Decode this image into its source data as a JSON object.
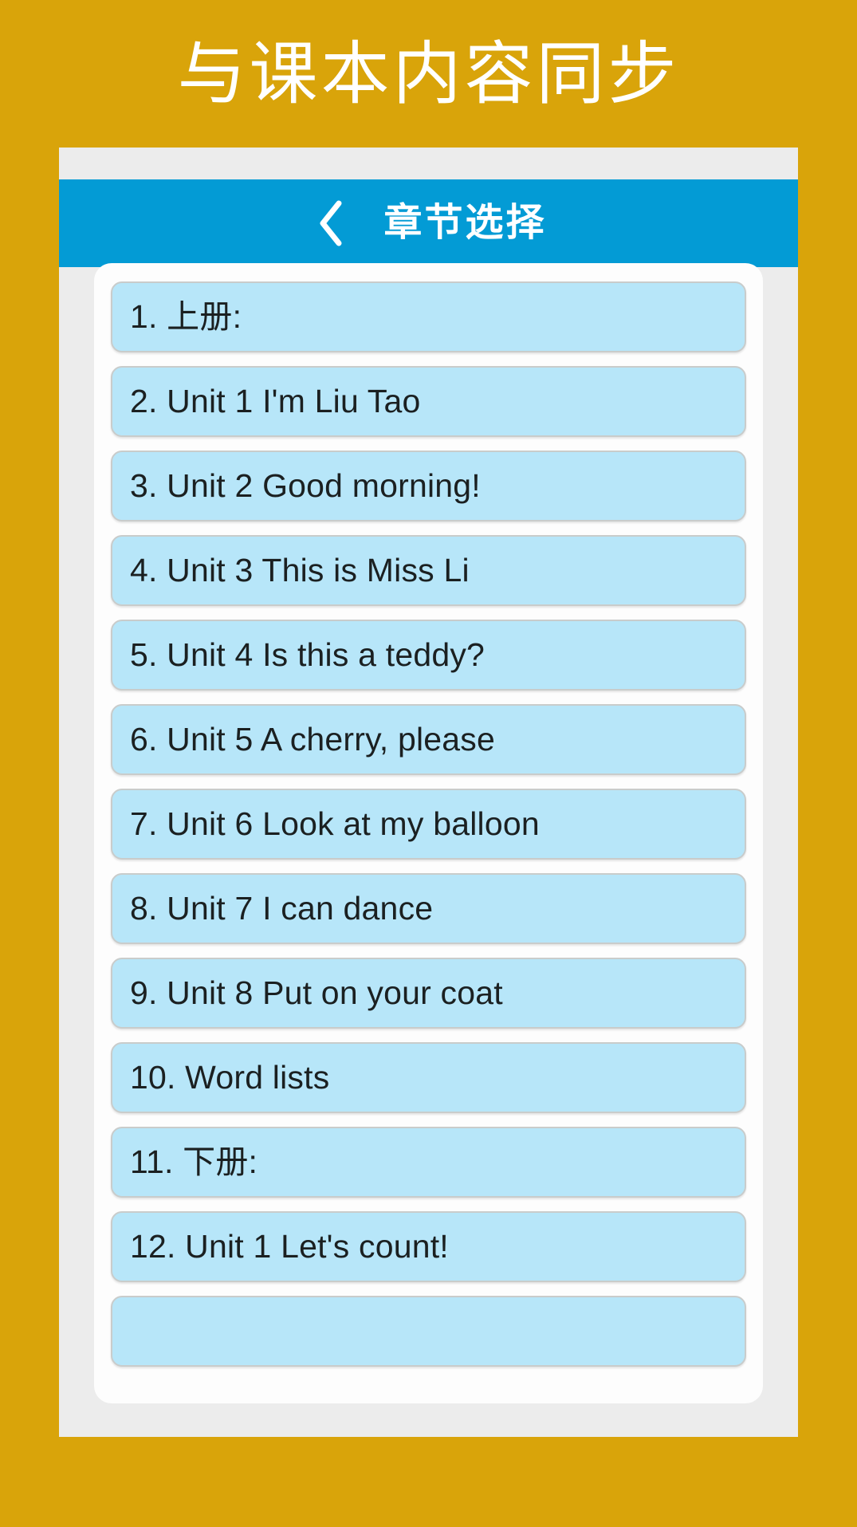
{
  "promo": {
    "headline": "与课本内容同步"
  },
  "app": {
    "header": {
      "back_icon": "chevron-left-icon",
      "title": "章节选择",
      "background_color": "#039BD5",
      "text_color": "#FFFFFF"
    },
    "colors": {
      "page_background": "#D9A40A",
      "phone_frame": "#ECECEC",
      "card_background": "#FDFDFD",
      "item_background": "#B7E6F9",
      "item_border": "#C9CCCB",
      "item_text": "#1B2021"
    },
    "chapter_list": {
      "items": [
        {
          "label": "1. 上册:"
        },
        {
          "label": "2. Unit 1 I'm Liu Tao"
        },
        {
          "label": "3. Unit 2 Good morning!"
        },
        {
          "label": "4. Unit 3 This is Miss Li"
        },
        {
          "label": "5. Unit 4 Is this a teddy?"
        },
        {
          "label": "6. Unit 5 A cherry, please"
        },
        {
          "label": "7. Unit 6 Look at my balloon"
        },
        {
          "label": "8. Unit 7 I can dance"
        },
        {
          "label": "9. Unit 8 Put on your coat"
        },
        {
          "label": "10. Word lists"
        },
        {
          "label": "11. 下册:"
        },
        {
          "label": "12. Unit 1 Let's count!"
        },
        {
          "label": ""
        }
      ]
    }
  }
}
